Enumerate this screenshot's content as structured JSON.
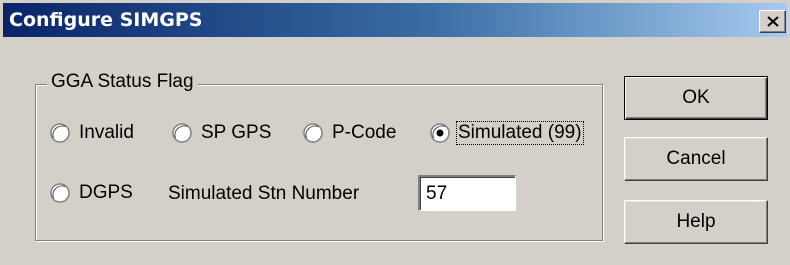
{
  "window": {
    "title": "Configure SIMGPS",
    "close_icon": "close-x-icon"
  },
  "group": {
    "legend": "GGA Status Flag",
    "radios": [
      {
        "label": "Invalid",
        "checked": false
      },
      {
        "label": "SP GPS",
        "checked": false
      },
      {
        "label": "P-Code",
        "checked": false
      },
      {
        "label": "Simulated (99)",
        "checked": true
      },
      {
        "label": "DGPS",
        "checked": false
      }
    ],
    "stn_label": "Simulated Stn Number",
    "stn_value": "57"
  },
  "buttons": {
    "ok": "OK",
    "cancel": "Cancel",
    "help": "Help"
  }
}
